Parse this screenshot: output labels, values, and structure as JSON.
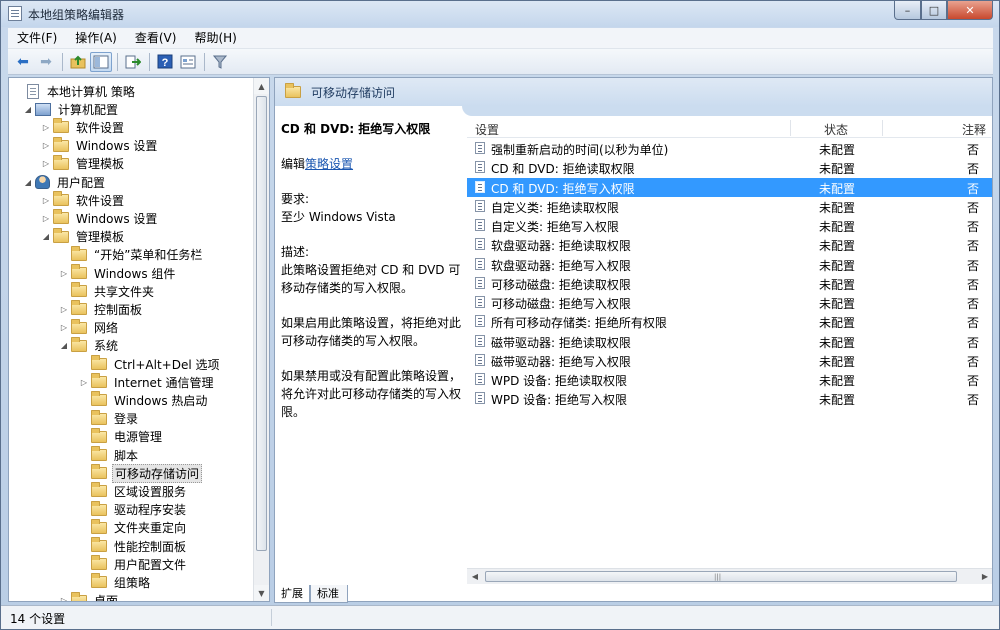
{
  "window": {
    "title": "本地组策略编辑器",
    "controls": {
      "minimize": "–",
      "maximize": "□",
      "close": "✕"
    }
  },
  "menu": [
    "文件(F)",
    "操作(A)",
    "查看(V)",
    "帮助(H)"
  ],
  "toolbar": {
    "icons": [
      "back-arrow-icon",
      "forward-arrow-icon",
      "up-folder-icon",
      "show-tree-icon",
      "export-list-icon",
      "help-icon",
      "properties-icon",
      "filter-icon"
    ]
  },
  "tree": [
    {
      "label": "本地计算机 策略",
      "icon": "doc",
      "level": 0,
      "expander": ""
    },
    {
      "label": "计算机配置",
      "icon": "pc",
      "level": 1,
      "expander": "◢"
    },
    {
      "label": "软件设置",
      "icon": "folder",
      "level": 2,
      "expander": "▷"
    },
    {
      "label": "Windows 设置",
      "icon": "folder",
      "level": 2,
      "expander": "▷"
    },
    {
      "label": "管理模板",
      "icon": "folder",
      "level": 2,
      "expander": "▷"
    },
    {
      "label": "用户配置",
      "icon": "user",
      "level": 1,
      "expander": "◢"
    },
    {
      "label": "软件设置",
      "icon": "folder",
      "level": 2,
      "expander": "▷"
    },
    {
      "label": "Windows 设置",
      "icon": "folder",
      "level": 2,
      "expander": "▷"
    },
    {
      "label": "管理模板",
      "icon": "folder",
      "level": 2,
      "expander": "◢"
    },
    {
      "label": "“开始”菜单和任务栏",
      "icon": "folder",
      "level": 3,
      "expander": ""
    },
    {
      "label": "Windows 组件",
      "icon": "folder",
      "level": 3,
      "expander": "▷"
    },
    {
      "label": "共享文件夹",
      "icon": "folder",
      "level": 3,
      "expander": ""
    },
    {
      "label": "控制面板",
      "icon": "folder",
      "level": 3,
      "expander": "▷"
    },
    {
      "label": "网络",
      "icon": "folder",
      "level": 3,
      "expander": "▷"
    },
    {
      "label": "系统",
      "icon": "folder",
      "level": 3,
      "expander": "◢"
    },
    {
      "label": "Ctrl+Alt+Del 选项",
      "icon": "folder",
      "level": 4,
      "expander": ""
    },
    {
      "label": "Internet 通信管理",
      "icon": "folder",
      "level": 4,
      "expander": "▷"
    },
    {
      "label": "Windows 热启动",
      "icon": "folder",
      "level": 4,
      "expander": ""
    },
    {
      "label": "登录",
      "icon": "folder",
      "level": 4,
      "expander": ""
    },
    {
      "label": "电源管理",
      "icon": "folder",
      "level": 4,
      "expander": ""
    },
    {
      "label": "脚本",
      "icon": "folder",
      "level": 4,
      "expander": ""
    },
    {
      "label": "可移动存储访问",
      "icon": "folder",
      "level": 4,
      "expander": "",
      "selected": true
    },
    {
      "label": "区域设置服务",
      "icon": "folder",
      "level": 4,
      "expander": ""
    },
    {
      "label": "驱动程序安装",
      "icon": "folder",
      "level": 4,
      "expander": ""
    },
    {
      "label": "文件夹重定向",
      "icon": "folder",
      "level": 4,
      "expander": ""
    },
    {
      "label": "性能控制面板",
      "icon": "folder",
      "level": 4,
      "expander": ""
    },
    {
      "label": "用户配置文件",
      "icon": "folder",
      "level": 4,
      "expander": ""
    },
    {
      "label": "组策略",
      "icon": "folder",
      "level": 4,
      "expander": ""
    },
    {
      "label": "桌面",
      "icon": "folder",
      "level": 3,
      "expander": "▷"
    }
  ],
  "right": {
    "header": "可移动存储访问",
    "description": {
      "title": "CD 和 DVD: 拒绝写入权限",
      "edit_prefix": "编辑",
      "edit_link": "策略设置",
      "req_label": "要求:",
      "req_value": "至少 Windows Vista",
      "desc_label": "描述:",
      "desc_text": "此策略设置拒绝对 CD 和 DVD 可移动存储类的写入权限。",
      "enabled_text": "如果启用此策略设置，将拒绝对此可移动存储类的写入权限。",
      "disabled_text": "如果禁用或没有配置此策略设置，将允许对此可移动存储类的写入权限。"
    },
    "columns": {
      "setting": "设置",
      "state": "状态",
      "comment": "注释"
    },
    "rows": [
      {
        "setting": "强制重新启动的时间(以秒为单位)",
        "state": "未配置",
        "comment": "否"
      },
      {
        "setting": "CD 和 DVD: 拒绝读取权限",
        "state": "未配置",
        "comment": "否"
      },
      {
        "setting": "CD 和 DVD: 拒绝写入权限",
        "state": "未配置",
        "comment": "否",
        "selected": true
      },
      {
        "setting": "自定义类: 拒绝读取权限",
        "state": "未配置",
        "comment": "否"
      },
      {
        "setting": "自定义类: 拒绝写入权限",
        "state": "未配置",
        "comment": "否"
      },
      {
        "setting": "软盘驱动器: 拒绝读取权限",
        "state": "未配置",
        "comment": "否"
      },
      {
        "setting": "软盘驱动器: 拒绝写入权限",
        "state": "未配置",
        "comment": "否"
      },
      {
        "setting": "可移动磁盘: 拒绝读取权限",
        "state": "未配置",
        "comment": "否"
      },
      {
        "setting": "可移动磁盘: 拒绝写入权限",
        "state": "未配置",
        "comment": "否"
      },
      {
        "setting": "所有可移动存储类: 拒绝所有权限",
        "state": "未配置",
        "comment": "否"
      },
      {
        "setting": "磁带驱动器: 拒绝读取权限",
        "state": "未配置",
        "comment": "否"
      },
      {
        "setting": "磁带驱动器: 拒绝写入权限",
        "state": "未配置",
        "comment": "否"
      },
      {
        "setting": "WPD 设备: 拒绝读取权限",
        "state": "未配置",
        "comment": "否"
      },
      {
        "setting": "WPD 设备: 拒绝写入权限",
        "state": "未配置",
        "comment": "否"
      }
    ],
    "tabs": [
      "扩展",
      "标准"
    ]
  },
  "status": "14 个设置",
  "colors": {
    "selection": "#3399ff",
    "link": "#1a56b0",
    "header_band": "#cbdcef"
  }
}
